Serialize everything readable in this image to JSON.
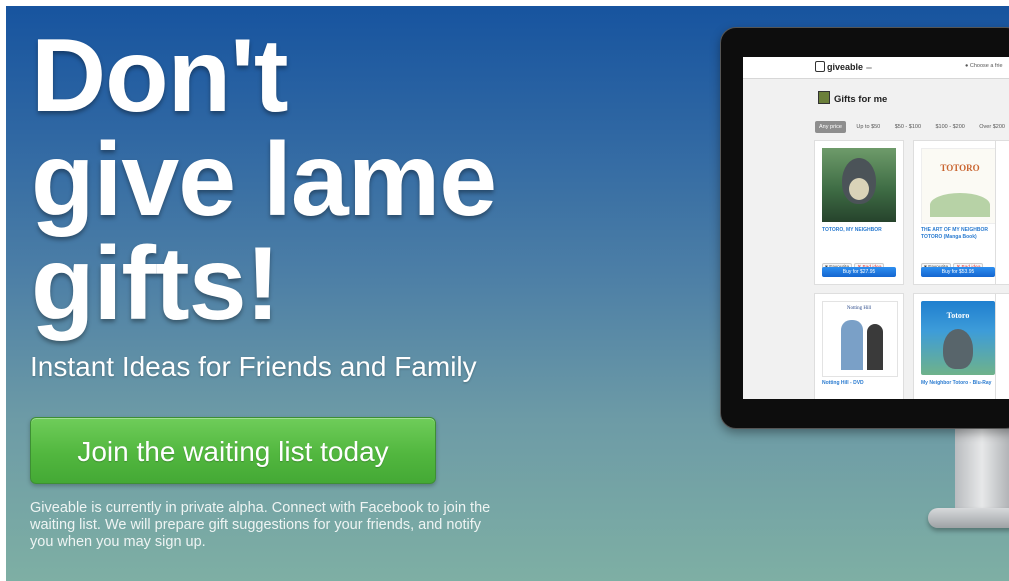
{
  "hero": {
    "headline_lines": [
      "Don't",
      "give lame",
      "gifts!"
    ],
    "subtitle": "Instant Ideas for Friends and Family",
    "cta_label": "Join the waiting list today",
    "note": "Giveable is currently in private alpha. Connect with Facebook to join the waiting list. We will prepare gift suggestions for your friends, and notify you when you may sign up."
  },
  "screenshot_app": {
    "logo": "giveable",
    "badge": "",
    "user_link": "Choose a frie",
    "heading": "Gifts for me",
    "filters": [
      "Any price",
      "Up to $50",
      "$50 - $100",
      "$100 - $200",
      "Over $200"
    ],
    "active_filter": "Any price",
    "products": [
      {
        "title": "TOTORO, MY NEIGHBOR",
        "favourite_label": "Favourite",
        "bad_label": "Bad idea",
        "buy_label": "Buy for $27.95"
      },
      {
        "title": "THE ART OF MY NEIGHBOR TOTORO (Manga Book)",
        "favourite_label": "Favourite",
        "bad_label": "Bad idea",
        "buy_label": "Buy for $53.95",
        "cover_title": "TOTORO"
      },
      {
        "title": "Notting Hill - DVD",
        "cover_title": "Notting Hill"
      },
      {
        "title": "My Neighbor Totoro - Blu-Ray",
        "cover_title": "Totoro"
      }
    ]
  },
  "colors": {
    "background_top": "#17549f",
    "background_bottom": "#7eafa4",
    "cta_green": "#52b73f",
    "link_blue": "#2a7bd0"
  }
}
